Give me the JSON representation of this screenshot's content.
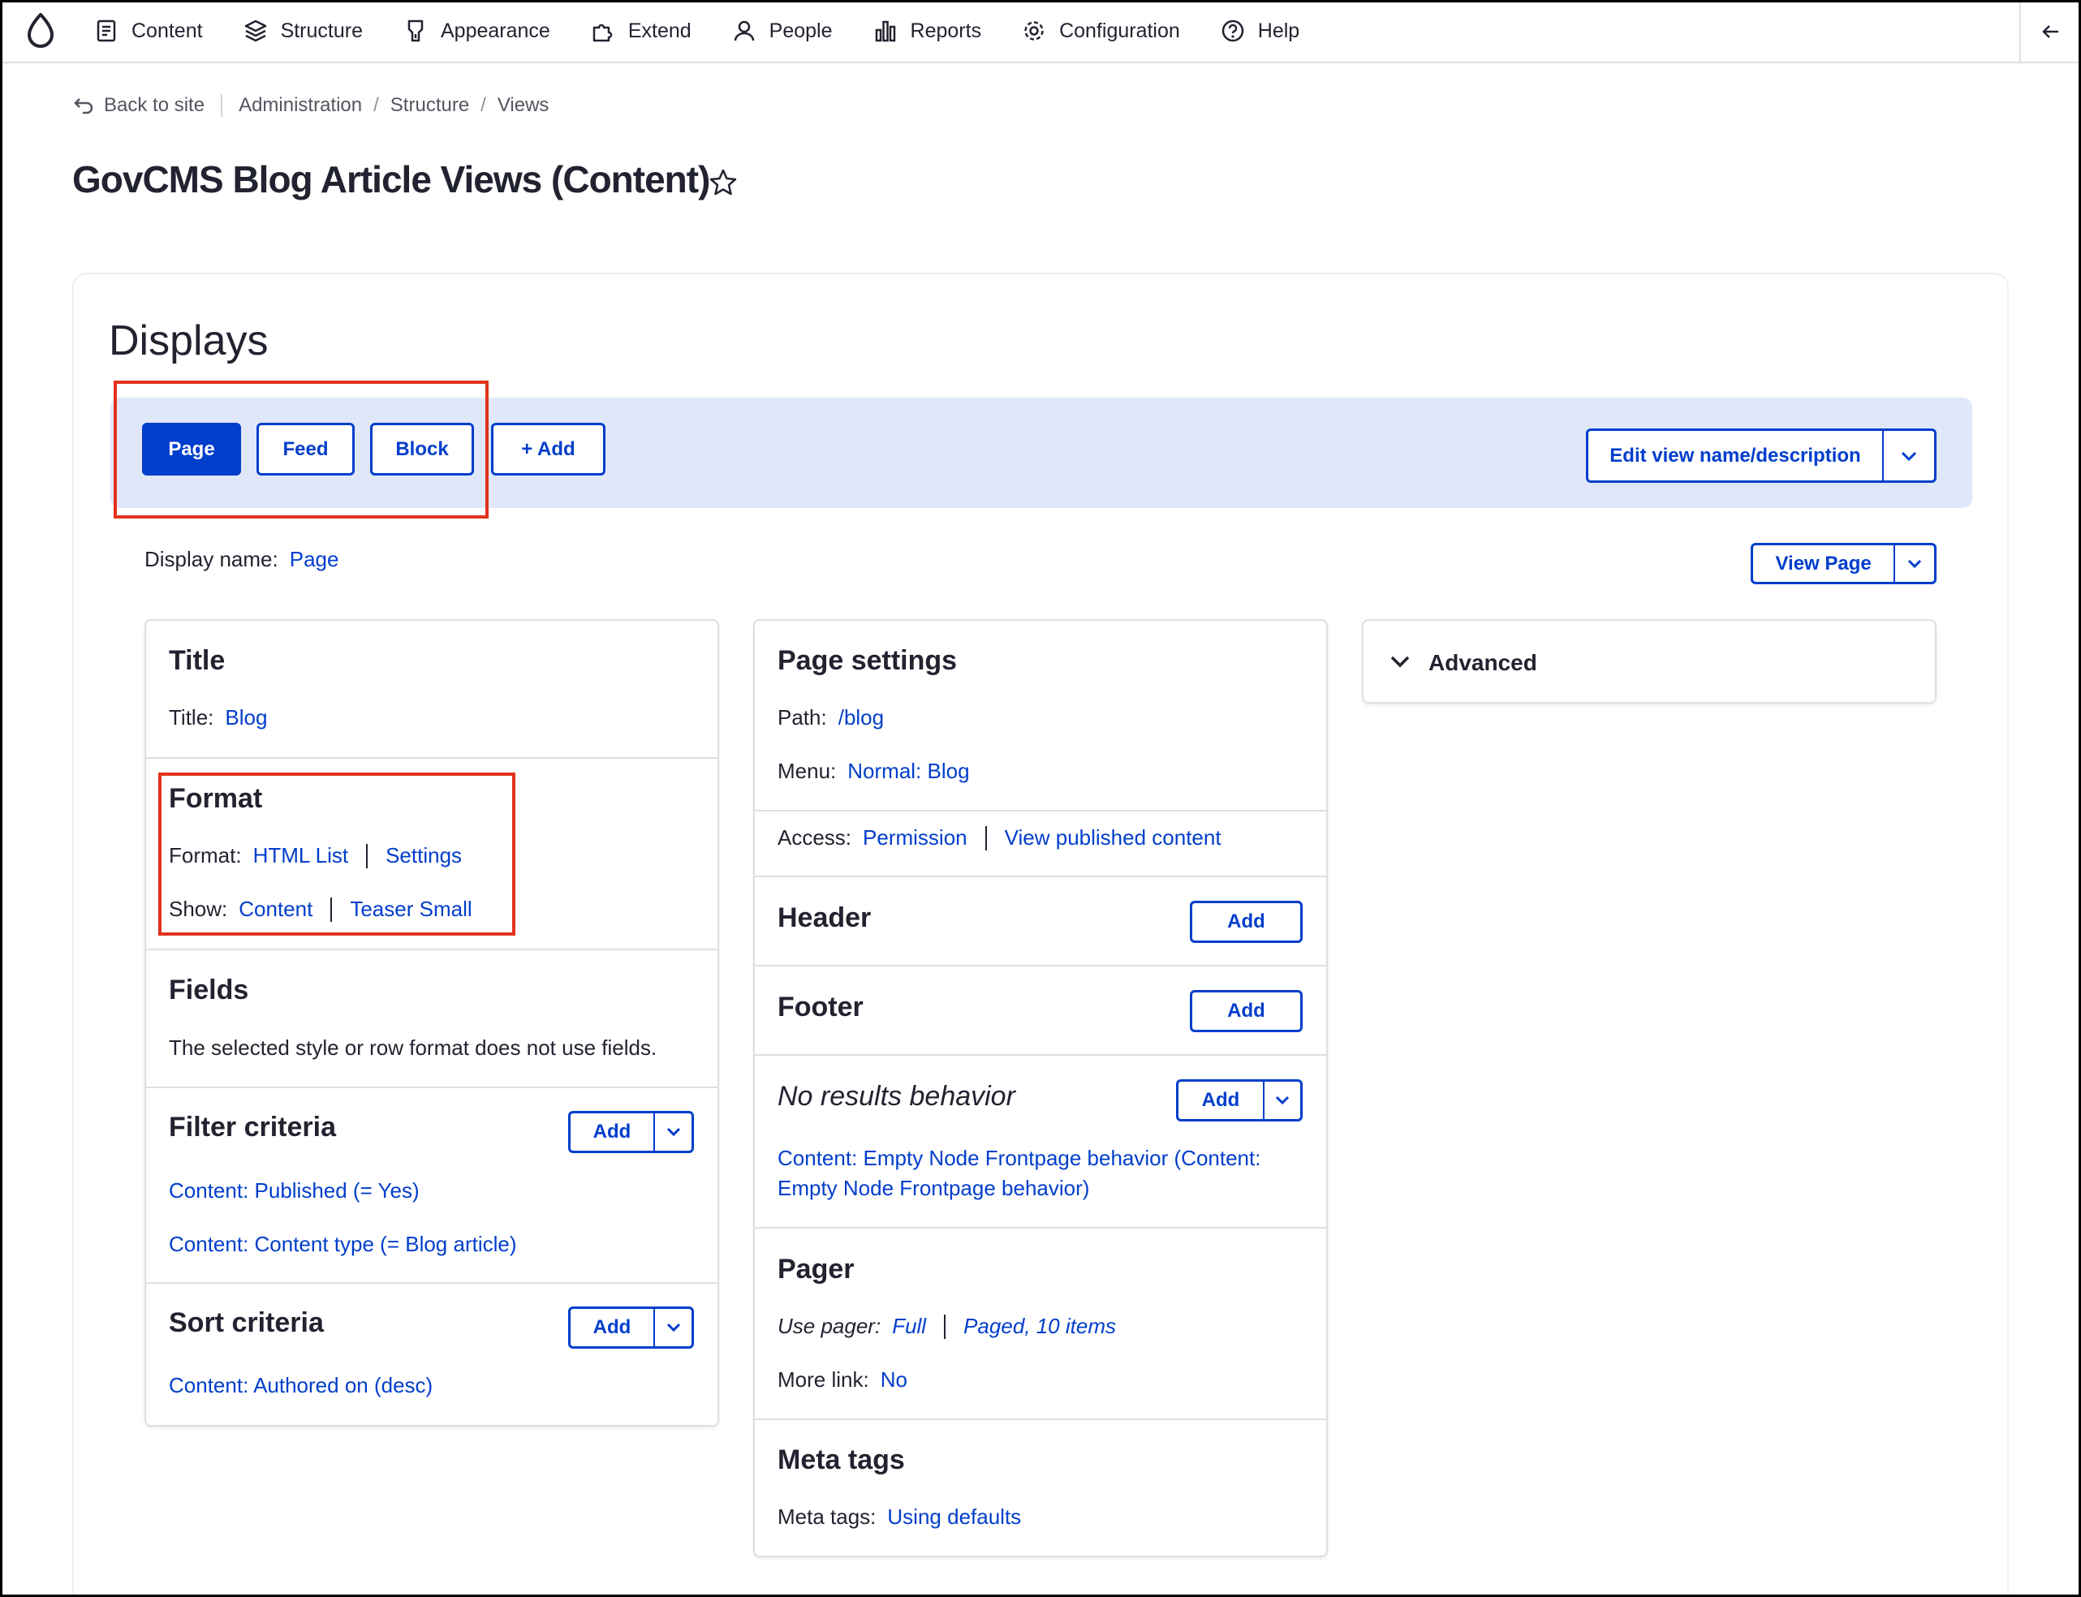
{
  "toolbar": {
    "items": [
      {
        "label": "Content",
        "icon": "content-icon"
      },
      {
        "label": "Structure",
        "icon": "structure-icon"
      },
      {
        "label": "Appearance",
        "icon": "appearance-icon"
      },
      {
        "label": "Extend",
        "icon": "extend-icon"
      },
      {
        "label": "People",
        "icon": "people-icon"
      },
      {
        "label": "Reports",
        "icon": "reports-icon"
      },
      {
        "label": "Configuration",
        "icon": "configuration-icon"
      },
      {
        "label": "Help",
        "icon": "help-icon"
      }
    ]
  },
  "breadcrumb": {
    "back": "Back to site",
    "items": [
      "Administration",
      "Structure",
      "Views"
    ]
  },
  "page_title": "GovCMS Blog Article Views (Content)",
  "displays": {
    "heading": "Displays",
    "tabs": [
      "Page",
      "Feed",
      "Block"
    ],
    "add_label": "+ Add",
    "edit_label": "Edit view name/description",
    "display_name_label": "Display name:",
    "display_name_value": "Page",
    "view_page_label": "View Page"
  },
  "col1": {
    "title": {
      "heading": "Title",
      "label": "Title:",
      "value": "Blog"
    },
    "format": {
      "heading": "Format",
      "format_label": "Format:",
      "format_value": "HTML List",
      "format_settings": "Settings",
      "show_label": "Show:",
      "show_value": "Content",
      "show_mode": "Teaser Small"
    },
    "fields": {
      "heading": "Fields",
      "text": "The selected style or row format does not use fields."
    },
    "filter": {
      "heading": "Filter criteria",
      "add": "Add",
      "items": [
        "Content: Published (= Yes)",
        "Content: Content type (= Blog article)"
      ]
    },
    "sort": {
      "heading": "Sort criteria",
      "add": "Add",
      "items": [
        "Content: Authored on (desc)"
      ]
    }
  },
  "col2": {
    "page_settings": {
      "heading": "Page settings",
      "path_label": "Path:",
      "path_value": "/blog",
      "menu_label": "Menu:",
      "menu_value": "Normal: Blog",
      "access_label": "Access:",
      "access_value": "Permission",
      "access_detail": "View published content"
    },
    "header": {
      "heading": "Header",
      "add": "Add"
    },
    "footer": {
      "heading": "Footer",
      "add": "Add"
    },
    "no_results": {
      "heading": "No results behavior",
      "add": "Add",
      "line1": "Content: Empty Node Frontpage behavior (Content:",
      "line2": "Empty Node Frontpage behavior)"
    },
    "pager": {
      "heading": "Pager",
      "use_label": "Use pager:",
      "use_value": "Full",
      "use_detail": "Paged, 10 items",
      "more_label": "More link:",
      "more_value": "No"
    },
    "meta": {
      "heading": "Meta tags",
      "label": "Meta tags:",
      "value": "Using defaults"
    }
  },
  "col3": {
    "advanced": "Advanced"
  },
  "colors": {
    "accent": "#003ecc",
    "highlight": "#e1321c",
    "tabs_bg": "#e0e7f8"
  }
}
